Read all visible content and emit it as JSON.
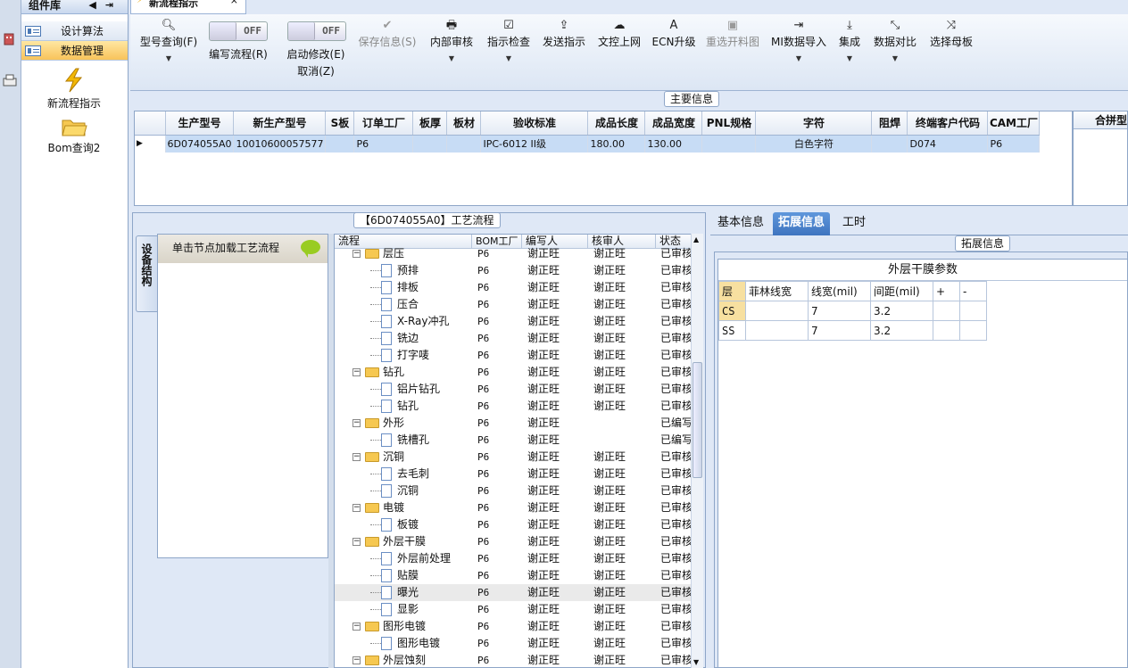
{
  "comp_panel": {
    "title": "组件库",
    "categories": [
      "设计算法",
      "数据管理"
    ],
    "items": [
      "新流程指示",
      "Bom查询2"
    ]
  },
  "tab": {
    "title": "新流程指示"
  },
  "toolbar": {
    "model_query": "型号查询(F)",
    "edit_flow_label": "编写流程(R)",
    "edit_flow_toggle": "OFF",
    "start_modify_label1": "启动修改(E)",
    "start_modify_label2": "取消(Z)",
    "start_modify_toggle": "OFF",
    "save_info": "保存信息(S)",
    "internal_review": "内部审核",
    "instr_check": "指示检查",
    "send_instr": "发送指示",
    "doc_upload": "文控上网",
    "ecn_upgrade": "ECN升级",
    "reselect_drawing": "重选开料图",
    "mi_import": "MI数据导入",
    "integrate": "集成",
    "data_compare": "数据对比",
    "select_master": "选择母板"
  },
  "main_info": {
    "caption": "主要信息",
    "columns": [
      "生产型号",
      "新生产型号",
      "S板",
      "订单工厂",
      "板厚",
      "板材",
      "验收标准",
      "成品长度",
      "成品宽度",
      "PNL规格",
      "字符",
      "阻焊",
      "终端客户代码",
      "CAM工厂"
    ],
    "row": [
      "6D074055A0",
      "10010600057577",
      "",
      "P6",
      "",
      "",
      "IPC-6012 II级",
      "180.00",
      "130.00",
      "",
      "白色字符",
      "",
      "D074",
      "P6"
    ],
    "right_header": "合拼型"
  },
  "process": {
    "caption": "【6D074055A0】工艺流程",
    "vtab": "设备结构",
    "node_hint": "单击节点加载工艺流程",
    "headers": {
      "flow": "流程",
      "bom": "BOM工厂",
      "writer": "编写人",
      "reviewer": "核审人",
      "status": "状态"
    },
    "rows": [
      {
        "level": 0,
        "name": "层压",
        "bom": "P6",
        "writer": "谢正旺",
        "reviewer": "谢正旺",
        "status": "已审核"
      },
      {
        "level": 1,
        "name": "预排",
        "bom": "P6",
        "writer": "谢正旺",
        "reviewer": "谢正旺",
        "status": "已审核"
      },
      {
        "level": 1,
        "name": "排板",
        "bom": "P6",
        "writer": "谢正旺",
        "reviewer": "谢正旺",
        "status": "已审核"
      },
      {
        "level": 1,
        "name": "压合",
        "bom": "P6",
        "writer": "谢正旺",
        "reviewer": "谢正旺",
        "status": "已审核"
      },
      {
        "level": 1,
        "name": "X-Ray冲孔",
        "bom": "P6",
        "writer": "谢正旺",
        "reviewer": "谢正旺",
        "status": "已审核"
      },
      {
        "level": 1,
        "name": "铣边",
        "bom": "P6",
        "writer": "谢正旺",
        "reviewer": "谢正旺",
        "status": "已审核"
      },
      {
        "level": 1,
        "name": "打字唛",
        "bom": "P6",
        "writer": "谢正旺",
        "reviewer": "谢正旺",
        "status": "已审核"
      },
      {
        "level": 0,
        "name": "钻孔",
        "bom": "P6",
        "writer": "谢正旺",
        "reviewer": "谢正旺",
        "status": "已审核"
      },
      {
        "level": 1,
        "name": "铝片钻孔",
        "bom": "P6",
        "writer": "谢正旺",
        "reviewer": "谢正旺",
        "status": "已审核"
      },
      {
        "level": 1,
        "name": "钻孔",
        "bom": "P6",
        "writer": "谢正旺",
        "reviewer": "谢正旺",
        "status": "已审核"
      },
      {
        "level": 0,
        "name": "外形",
        "bom": "P6",
        "writer": "谢正旺",
        "reviewer": "",
        "status": "已编写"
      },
      {
        "level": 1,
        "name": "铣槽孔",
        "bom": "P6",
        "writer": "谢正旺",
        "reviewer": "",
        "status": "已编写"
      },
      {
        "level": 0,
        "name": "沉铜",
        "bom": "P6",
        "writer": "谢正旺",
        "reviewer": "谢正旺",
        "status": "已审核"
      },
      {
        "level": 1,
        "name": "去毛刺",
        "bom": "P6",
        "writer": "谢正旺",
        "reviewer": "谢正旺",
        "status": "已审核"
      },
      {
        "level": 1,
        "name": "沉铜",
        "bom": "P6",
        "writer": "谢正旺",
        "reviewer": "谢正旺",
        "status": "已审核"
      },
      {
        "level": 0,
        "name": "电镀",
        "bom": "P6",
        "writer": "谢正旺",
        "reviewer": "谢正旺",
        "status": "已审核"
      },
      {
        "level": 1,
        "name": "板镀",
        "bom": "P6",
        "writer": "谢正旺",
        "reviewer": "谢正旺",
        "status": "已审核"
      },
      {
        "level": 0,
        "name": "外层干膜",
        "bom": "P6",
        "writer": "谢正旺",
        "reviewer": "谢正旺",
        "status": "已审核"
      },
      {
        "level": 1,
        "name": "外层前处理",
        "bom": "P6",
        "writer": "谢正旺",
        "reviewer": "谢正旺",
        "status": "已审核"
      },
      {
        "level": 1,
        "name": "贴膜",
        "bom": "P6",
        "writer": "谢正旺",
        "reviewer": "谢正旺",
        "status": "已审核"
      },
      {
        "level": 1,
        "name": "曝光",
        "bom": "P6",
        "writer": "谢正旺",
        "reviewer": "谢正旺",
        "status": "已审核",
        "selected": true
      },
      {
        "level": 1,
        "name": "显影",
        "bom": "P6",
        "writer": "谢正旺",
        "reviewer": "谢正旺",
        "status": "已审核"
      },
      {
        "level": 0,
        "name": "图形电镀",
        "bom": "P6",
        "writer": "谢正旺",
        "reviewer": "谢正旺",
        "status": "已审核"
      },
      {
        "level": 1,
        "name": "图形电镀",
        "bom": "P6",
        "writer": "谢正旺",
        "reviewer": "谢正旺",
        "status": "已审核"
      },
      {
        "level": 0,
        "name": "外层蚀刻",
        "bom": "P6",
        "writer": "谢正旺",
        "reviewer": "谢正旺",
        "status": "已审核"
      }
    ]
  },
  "right_tabs": [
    "基本信息",
    "拓展信息",
    "工时"
  ],
  "ext_info": {
    "caption": "拓展信息",
    "table_title": "外层干膜参数",
    "headers": [
      "层",
      "菲林线宽",
      "线宽(mil)",
      "间距(mil)",
      "+",
      "-"
    ],
    "rows": [
      [
        "CS",
        "",
        "7",
        "3.2",
        "",
        ""
      ],
      [
        "SS",
        "",
        "7",
        "3.2",
        "",
        ""
      ]
    ]
  }
}
